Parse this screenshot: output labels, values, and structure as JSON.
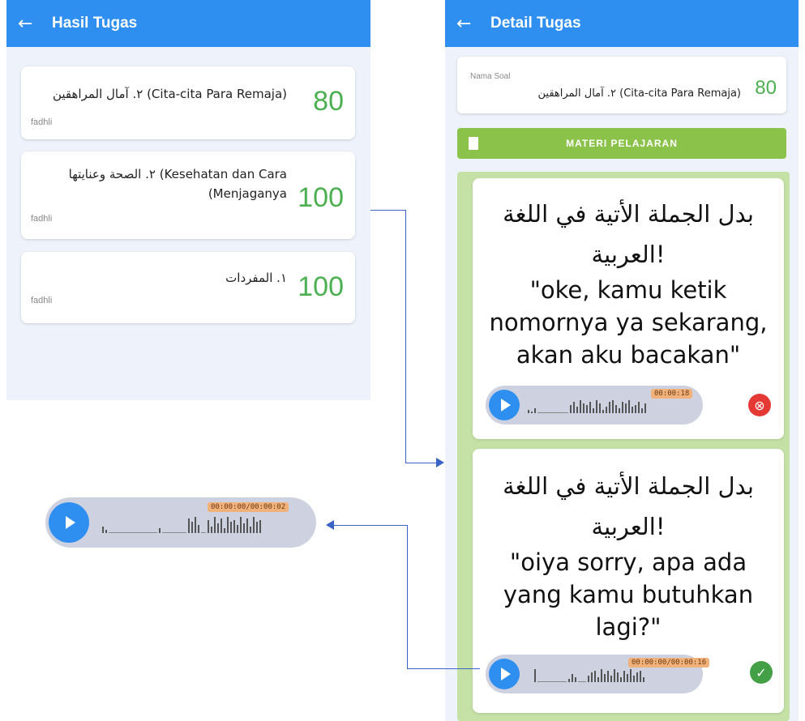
{
  "hasil": {
    "title": "Hasil Tugas",
    "back_icon": "←",
    "items": [
      {
        "name": "٢. آمال المراهقين (Cita-cita Para Remaja)",
        "score": "80",
        "user": "fadhli"
      },
      {
        "name": "٢. الصحة وعنايتها (Kesehatan dan Cara (Menjaganya",
        "score": "100",
        "user": "fadhli"
      },
      {
        "name": "١. المفردات",
        "score": "100",
        "user": "fadhli"
      }
    ]
  },
  "detail": {
    "title": "Detail Tugas",
    "back_icon": "←",
    "nama_soal_label": "Nama Soal",
    "nama_soal_value": "٢. آمال المراهقين (Cita-cita Para Remaja)",
    "score": "80",
    "materi_label": "MATERI PELAJARAN",
    "questions": [
      {
        "arabic_line1": "بدل الجملة الأتية في اللغة",
        "arabic_line2": "العربية!",
        "latin_line1": "\"oke, kamu ketik",
        "latin_line2": "nomornya ya sekarang,",
        "latin_line3": "akan aku bacakan\"",
        "time": "00:00:18",
        "status": "wrong",
        "status_icon": "⊗"
      },
      {
        "arabic_line1": "بدل الجملة الأتية في اللغة",
        "arabic_line2": "العربية!",
        "latin_line1": "\"oiya sorry, apa ada",
        "latin_line2": "yang kamu butuhkan",
        "latin_line3": "lagi?\"",
        "time": "00:00:00/00:00:16",
        "status": "correct",
        "status_icon": "✓"
      }
    ]
  },
  "zoom_player": {
    "time": "00:00:00/00:00:02"
  },
  "colors": {
    "primary": "#2f8ff0",
    "score_green": "#4caf50",
    "materi_green": "#8bc34a",
    "wrong_red": "#e53935",
    "correct_green": "#43a047",
    "connector": "#3a65c4"
  }
}
